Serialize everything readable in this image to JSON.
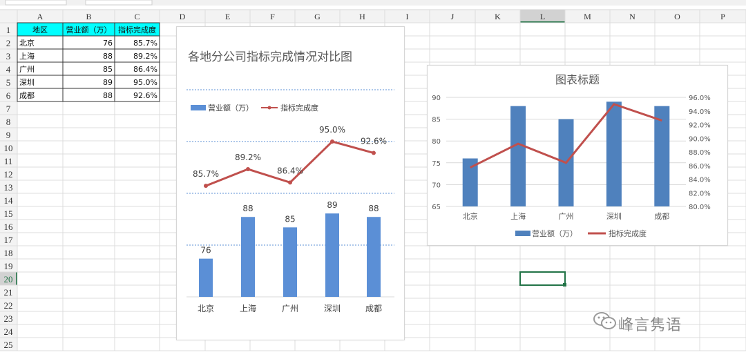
{
  "spreadsheet": {
    "top_tabs": [
      "",
      ""
    ],
    "column_headers": [
      "A",
      "B",
      "C",
      "D",
      "E",
      "F",
      "G",
      "H",
      "I",
      "J",
      "K",
      "L",
      "M",
      "N",
      "O",
      "P"
    ],
    "row_headers": [
      "1",
      "2",
      "3",
      "4",
      "5",
      "6",
      "7",
      "8",
      "9",
      "10",
      "11",
      "12",
      "13",
      "14",
      "15",
      "16",
      "17",
      "18",
      "19",
      "20",
      "21",
      "22",
      "23",
      "24",
      "25"
    ],
    "selected_column": "L",
    "selected_row": "20",
    "table_header": [
      "地区",
      "营业额（万）",
      "指标完成度"
    ],
    "header_fill": "#00FFFF",
    "rows": [
      [
        "北京",
        "76",
        "85.7%"
      ],
      [
        "上海",
        "88",
        "89.2%"
      ],
      [
        "广州",
        "85",
        "86.4%"
      ],
      [
        "深圳",
        "89",
        "95.0%"
      ],
      [
        "成都",
        "88",
        "92.6%"
      ]
    ]
  },
  "chart_data": [
    {
      "type": "bar+line",
      "title": "各地分公司指标完成情况对比图",
      "categories": [
        "北京",
        "上海",
        "广州",
        "深圳",
        "成都"
      ],
      "series": [
        {
          "name": "营业额（万）",
          "type": "bar",
          "values": [
            76,
            88,
            85,
            89,
            88
          ],
          "color": "#5B8FD6",
          "data_labels": [
            "76",
            "88",
            "85",
            "89",
            "88"
          ]
        },
        {
          "name": "指标完成度",
          "type": "line",
          "values": [
            85.7,
            89.2,
            86.4,
            95.0,
            92.6
          ],
          "color": "#C0504D",
          "data_labels": [
            "85.7%",
            "89.2%",
            "86.4%",
            "95.0%",
            "92.6%"
          ]
        }
      ],
      "legend_position": "top",
      "grid": "dashed"
    },
    {
      "type": "bar+line",
      "title": "图表标题",
      "categories": [
        "北京",
        "上海",
        "广州",
        "深圳",
        "成都"
      ],
      "series": [
        {
          "name": "营业额（万）",
          "type": "bar",
          "values": [
            76,
            88,
            85,
            89,
            88
          ],
          "color": "#4F81BD"
        },
        {
          "name": "指标完成度",
          "type": "line",
          "values": [
            85.7,
            89.2,
            86.4,
            95.0,
            92.6
          ],
          "color": "#C0504D"
        }
      ],
      "y_left": {
        "ticks": [
          "65",
          "70",
          "75",
          "80",
          "85",
          "90"
        ],
        "range": [
          65,
          90
        ]
      },
      "y_right": {
        "ticks": [
          "80.0%",
          "82.0%",
          "84.0%",
          "86.0%",
          "88.0%",
          "90.0%",
          "92.0%",
          "94.0%",
          "96.0%"
        ],
        "range": [
          80,
          96
        ]
      },
      "legend_position": "bottom",
      "grid": true
    }
  ],
  "watermark": {
    "text": "峰言隽语",
    "icon": "wechat-icon"
  }
}
